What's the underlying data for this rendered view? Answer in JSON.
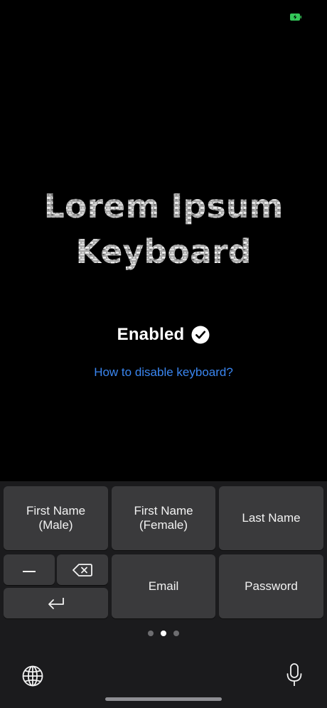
{
  "status_bar": {
    "battery_icon": "battery-charging-icon",
    "battery_color": "#34c759"
  },
  "hero": {
    "title_line1": "Lorem Ipsum",
    "title_line2": "Keyboard",
    "status_text": "Enabled",
    "status_icon": "checkmark-circle-icon",
    "help_link": "How to disable keyboard?",
    "link_color": "#3a86f0"
  },
  "keyboard": {
    "keys": {
      "first_name_male_line1": "First Name",
      "first_name_male_line2": "(Male)",
      "first_name_female_line1": "First Name",
      "first_name_female_line2": "(Female)",
      "last_name": "Last Name",
      "space": "space-icon",
      "delete": "delete-icon",
      "return": "return-icon",
      "email": "Email",
      "password": "Password"
    },
    "page_indicator": {
      "pages": 3,
      "current": 2
    },
    "globe_icon": "globe-icon",
    "mic_icon": "microphone-icon"
  }
}
